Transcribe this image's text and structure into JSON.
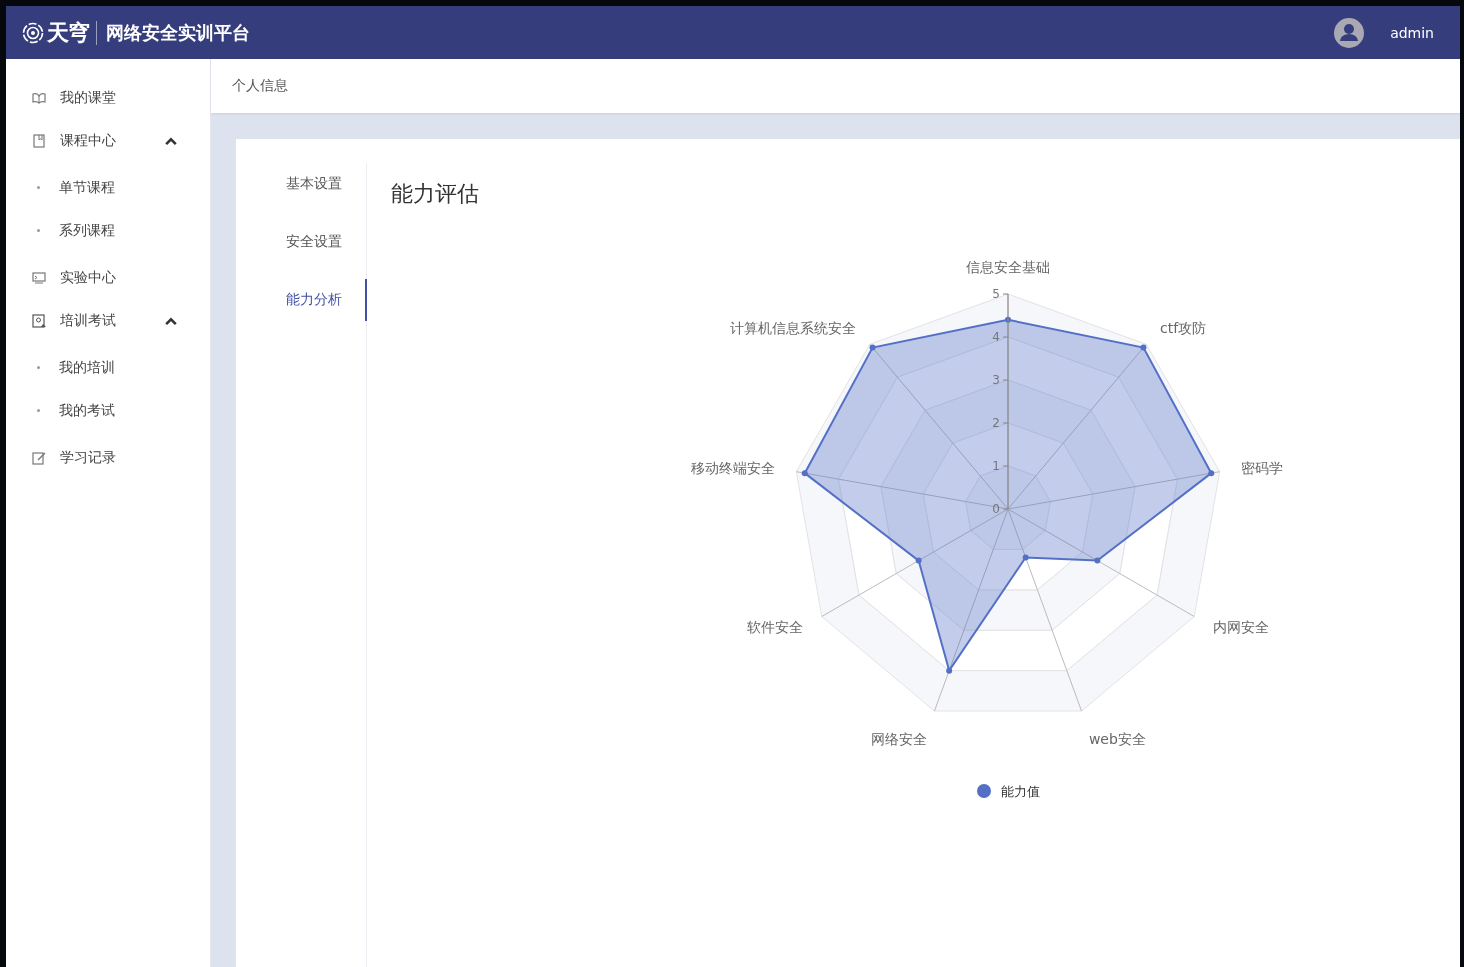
{
  "header": {
    "logo_text": "天穹",
    "title": "网络安全实训平台",
    "user": "admin"
  },
  "sidebar": {
    "items": [
      {
        "label": "我的课堂",
        "kind": "book"
      },
      {
        "label": "课程中心",
        "kind": "bookmark",
        "expanded": true,
        "children": [
          {
            "label": "单节课程"
          },
          {
            "label": "系列课程"
          }
        ]
      },
      {
        "label": "实验中心",
        "kind": "monitor"
      },
      {
        "label": "培训考试",
        "kind": "badge",
        "expanded": true,
        "children": [
          {
            "label": "我的培训"
          },
          {
            "label": "我的考试"
          }
        ]
      },
      {
        "label": "学习记录",
        "kind": "edit"
      }
    ]
  },
  "breadcrumb": "个人信息",
  "tabs": [
    {
      "label": "基本设置",
      "selected": false
    },
    {
      "label": "安全设置",
      "selected": false
    },
    {
      "label": "能力分析",
      "selected": true
    }
  ],
  "panel": {
    "title": "能力评估",
    "chart_data": {
      "type": "radar",
      "categories": [
        "信息安全基础",
        "ctf攻防",
        "密码学",
        "内网安全",
        "web安全",
        "网络安全",
        "软件安全",
        "移动终端安全",
        "计算机信息系统安全"
      ],
      "ylim": [
        0,
        5
      ],
      "yticks": [
        0,
        1,
        2,
        3,
        4,
        5
      ],
      "series": [
        {
          "name": "能力值",
          "color": "#5470c6",
          "values": [
            4.4,
            4.9,
            4.8,
            2.4,
            1.2,
            4.0,
            2.4,
            4.8,
            4.9
          ]
        }
      ]
    }
  }
}
